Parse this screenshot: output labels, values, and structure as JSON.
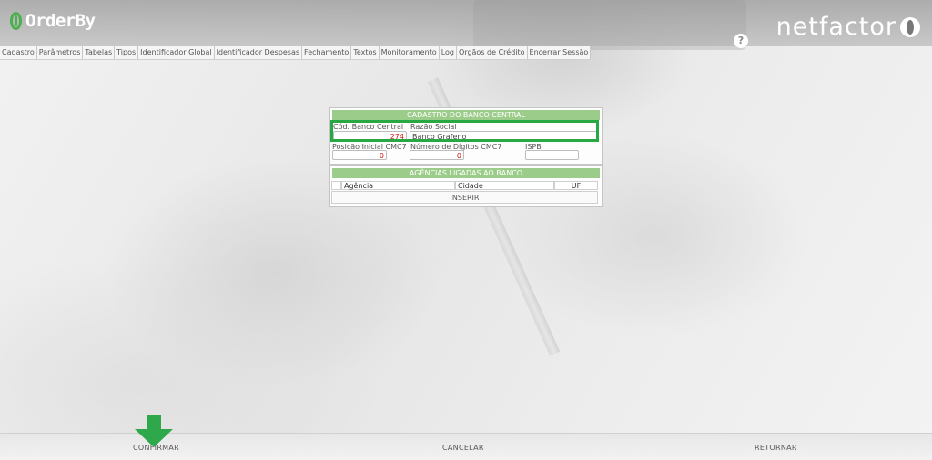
{
  "brand": {
    "orderby": "OrderBy",
    "netfactor": "netfactor"
  },
  "help_icon": "?",
  "menu": [
    "Cadastro",
    "Parâmetros",
    "Tabelas",
    "Tipos",
    "Identificador Global",
    "Identificador Despesas",
    "Fechamento",
    "Textos",
    "Monitoramento",
    "Log",
    "Orgãos de Crédito",
    "Encerrar Sessão"
  ],
  "form": {
    "title": "CADASTRO DO BANCO CENTRAL",
    "cod_label": "Cód. Banco Central",
    "cod_value": "274",
    "razao_label": "Razão Social",
    "razao_value": "Banco Grafeno",
    "posicao_label": "Posição Inicial CMC7",
    "posicao_value": "0",
    "numero_label": "Número de Dígitos CMC7",
    "numero_value": "0",
    "ispb_label": "ISPB",
    "ispb_value": ""
  },
  "agencias": {
    "title": "AGÊNCIAS LIGADAS AO BANCO",
    "columns": [
      "Agência",
      "Cidade",
      "UF"
    ],
    "insert_label": "INSERIR"
  },
  "footer": {
    "confirm": "CONFIRMAR",
    "cancel": "CANCELAR",
    "return": "RETORNAR"
  },
  "colors": {
    "accent": "#27a844",
    "header_green": "#9ccc8a",
    "value_red": "#d11111"
  }
}
